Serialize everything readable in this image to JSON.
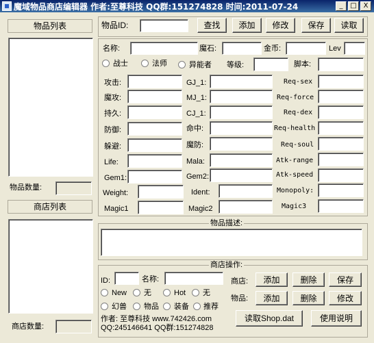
{
  "window": {
    "title": "魔域物品商店编辑器  作者:至尊科技 QQ群:151274828 时间:2011-07-24",
    "min": "_",
    "max": "□",
    "close": "X"
  },
  "left": {
    "item_list_header": "物品列表",
    "item_count_label": "物品数量:",
    "shop_list_header": "商店列表",
    "shop_count_label": "商店数量:"
  },
  "top": {
    "item_id_label": "物品ID:",
    "find": "查找",
    "add": "添加",
    "modify": "修改",
    "save": "保存",
    "read": "读取"
  },
  "form": {
    "name": "名称:",
    "magic_stone": "魔石:",
    "gold": "金币:",
    "lev": "Lev",
    "classes": [
      "战士",
      "法师",
      "异能者"
    ],
    "level": "等级:",
    "script": "脚本:",
    "col1": [
      "攻击:",
      "魔攻:",
      "持久:",
      "防御:",
      "躲避:",
      "Life:",
      "Gem1:",
      "Weight:",
      "Magic1"
    ],
    "col2": [
      "GJ_1:",
      "MJ_1:",
      "CJ_1:",
      "命中:",
      "魔防:",
      "Mala:",
      "Gem2:",
      "Ident:",
      "Magic2"
    ],
    "col3": [
      "Req-sex",
      "Req-force",
      "Req-dex",
      "Req-health",
      "Req-soul",
      "Atk-range",
      "Atk-speed",
      "Monopoly:",
      "Magic3"
    ]
  },
  "desc": {
    "legend": "物品描述:"
  },
  "shopops": {
    "legend": "商店操作:",
    "id": "ID:",
    "name": "名称:",
    "shop": "商店:",
    "item": "物品:",
    "add": "添加",
    "delete": "删除",
    "save": "保存",
    "modify": "修改",
    "radios1": [
      "New",
      "无",
      "Hot",
      "无"
    ],
    "radios2": [
      "幻兽",
      "物品",
      "装备",
      "推荐"
    ],
    "author": "作者: 至尊科技 www.742426.com",
    "qq": "QQ:245146641 QQ群:151274828",
    "read_shop": "读取Shop.dat",
    "help": "使用说明"
  }
}
